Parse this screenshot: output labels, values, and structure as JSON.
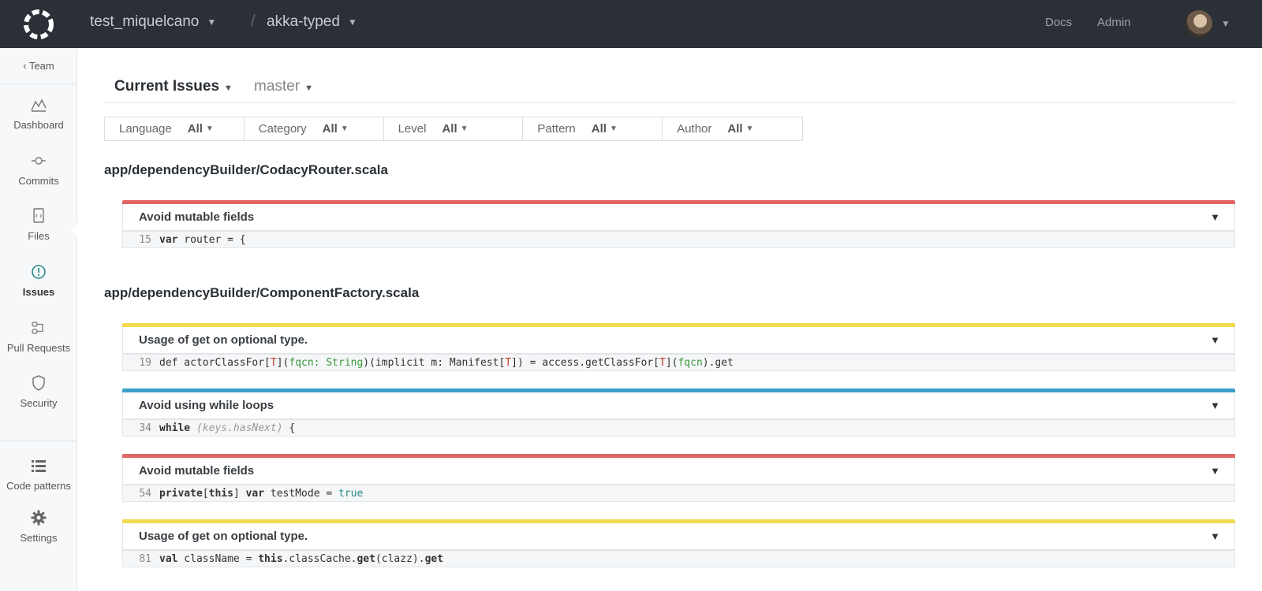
{
  "topbar": {
    "org": "test_miquelcano",
    "repo": "akka-typed",
    "separator": "/",
    "docs": "Docs",
    "admin": "Admin",
    "chevron": "⌄"
  },
  "sidebar": {
    "back": "‹ Team",
    "items": [
      {
        "label": "Dashboard",
        "icon": "chart-icon"
      },
      {
        "label": "Commits",
        "icon": "commit-icon"
      },
      {
        "label": "Files",
        "icon": "file-icon"
      },
      {
        "label": "Issues",
        "icon": "alert-icon"
      },
      {
        "label": "Pull Requests",
        "icon": "pull-request-icon"
      },
      {
        "label": "Security",
        "icon": "shield-icon"
      },
      {
        "label": "Code patterns",
        "icon": "list-icon"
      },
      {
        "label": "Settings",
        "icon": "gear-icon"
      }
    ]
  },
  "header": {
    "view": "Current Issues",
    "branch": "master"
  },
  "filters": [
    {
      "label": "Language",
      "value": "All"
    },
    {
      "label": "Category",
      "value": "All"
    },
    {
      "label": "Level",
      "value": "All"
    },
    {
      "label": "Pattern",
      "value": "All"
    },
    {
      "label": "Author",
      "value": "All"
    }
  ],
  "files": [
    {
      "path": "app/dependencyBuilder/CodacyRouter.scala",
      "issues": [
        {
          "title": "Avoid mutable fields",
          "level_color": "#e06666",
          "line": "15",
          "code": "var router = {"
        }
      ]
    },
    {
      "path": "app/dependencyBuilder/ComponentFactory.scala",
      "issues": [
        {
          "title": "Usage of get on optional type.",
          "level_color": "#f0db4f",
          "line": "19",
          "code": "def actorClassFor[T](fqcn: String)(implicit m: Manifest[T]) = access.getClassFor[T](fqcn).get"
        },
        {
          "title": "Avoid using while loops",
          "level_color": "#3b9fc9",
          "line": "34",
          "code": "while (keys.hasNext) {"
        },
        {
          "title": "Avoid mutable fields",
          "level_color": "#e06666",
          "line": "54",
          "code": "private[this] var testMode = true"
        },
        {
          "title": "Usage of get on optional type.",
          "level_color": "#f0db4f",
          "line": "81",
          "code": "val className = this.classCache.get(clazz).get"
        }
      ]
    }
  ]
}
